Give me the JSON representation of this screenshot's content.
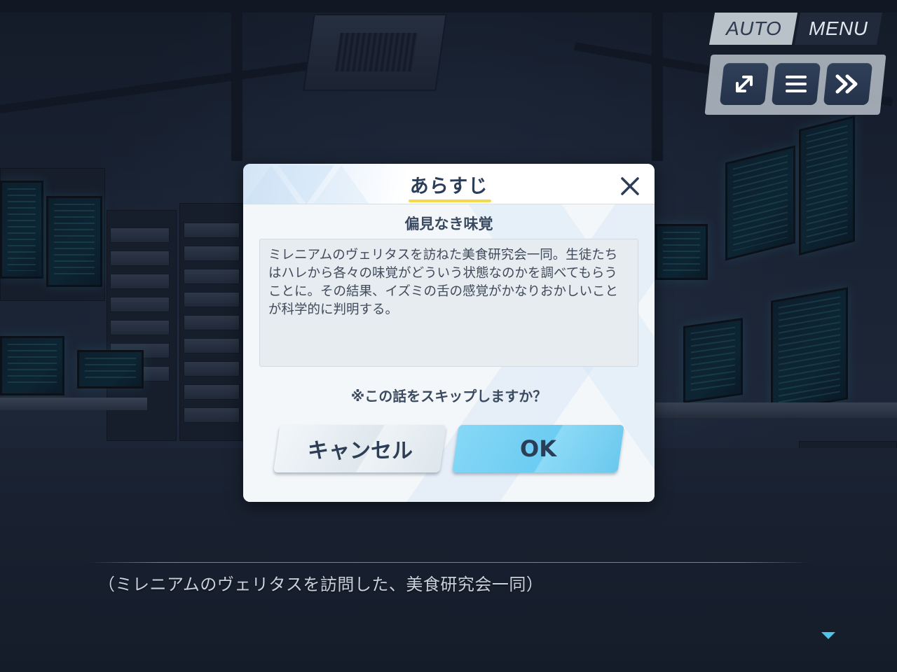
{
  "hud": {
    "auto_label": "AUTO",
    "menu_label": "MENU",
    "buttons": [
      {
        "icon": "expand-icon"
      },
      {
        "icon": "log-list-icon"
      },
      {
        "icon": "skip-forward-icon"
      }
    ]
  },
  "dialog": {
    "title": "あらすじ",
    "episode_title": "偏見なき味覚",
    "summary": "ミレニアムのヴェリタスを訪ねた美食研究会一同。生徒たちはハレから各々の味覚がどういう状態なのかを調べてもらうことに。その結果、イズミの舌の感覚がかなりおかしいことが科学的に判明する。",
    "skip_question": "※この話をスキップしますか？",
    "cancel_label": "キャンセル",
    "ok_label": "OK",
    "colors": {
      "title_underline": "#f6d94a",
      "ok_button": "#6ccbf2",
      "text": "#2b3d57"
    }
  },
  "narration": {
    "text": "（ミレニアムのヴェリタスを訪問した、美食研究会一同）"
  }
}
